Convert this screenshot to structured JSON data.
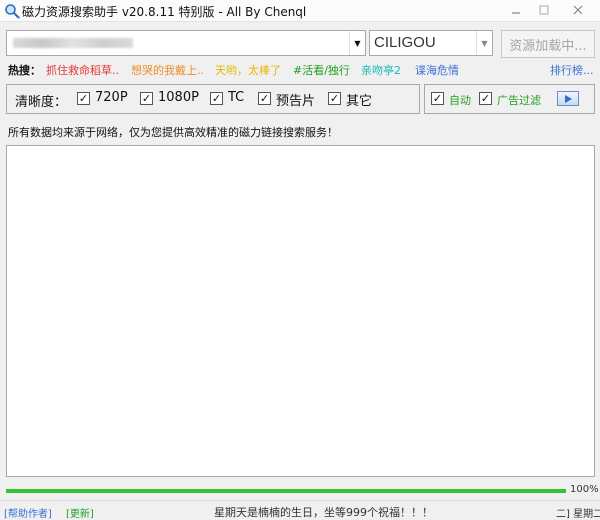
{
  "window": {
    "title": "磁力资源搜索助手 v20.8.11 特别版 - All By Chenql"
  },
  "search": {
    "value": "",
    "source": "CILIGOU",
    "load_button": "资源加载中..."
  },
  "hot": {
    "label": "热搜：",
    "items": [
      {
        "text": "抓住救命稻草..",
        "color": "#e53935"
      },
      {
        "text": "想哭的我戴上..",
        "color": "#ef8c2a"
      },
      {
        "text": "天哟，太棒了",
        "color": "#e6b800"
      },
      {
        "text": "#活看/独行",
        "color": "#22a022"
      },
      {
        "text": "亲吻亭2",
        "color": "#1fb6b6"
      },
      {
        "text": "谍海危情",
        "color": "#3b6fd6"
      }
    ],
    "rank_link": "排行榜..."
  },
  "filters": {
    "title": "清晰度：",
    "options": [
      {
        "label": "720P",
        "checked": "✓"
      },
      {
        "label": "1080P",
        "checked": "✓"
      },
      {
        "label": "TC",
        "checked": "✓"
      },
      {
        "label": "预告片",
        "checked": "✓"
      },
      {
        "label": "其它",
        "checked": "✓"
      }
    ]
  },
  "options": {
    "auto": {
      "label": "自动",
      "checked": "✓"
    },
    "ad_filter": {
      "label": "广告过滤",
      "checked": "✓"
    }
  },
  "notice": "所有数据均来源于网络，仅为您提供高效精准的磁力链接搜索服务！",
  "progress": {
    "value": 100,
    "text": "100%"
  },
  "status": {
    "help": "[帮助作者]",
    "update": "[更新]",
    "message": "星期天是楠楠的生日，坐等999个祝福！！！",
    "day": "二]  星期二"
  },
  "colors": {
    "progress": "#36c236",
    "link_blue": "#3b6fd6",
    "link_green": "#22a022"
  }
}
